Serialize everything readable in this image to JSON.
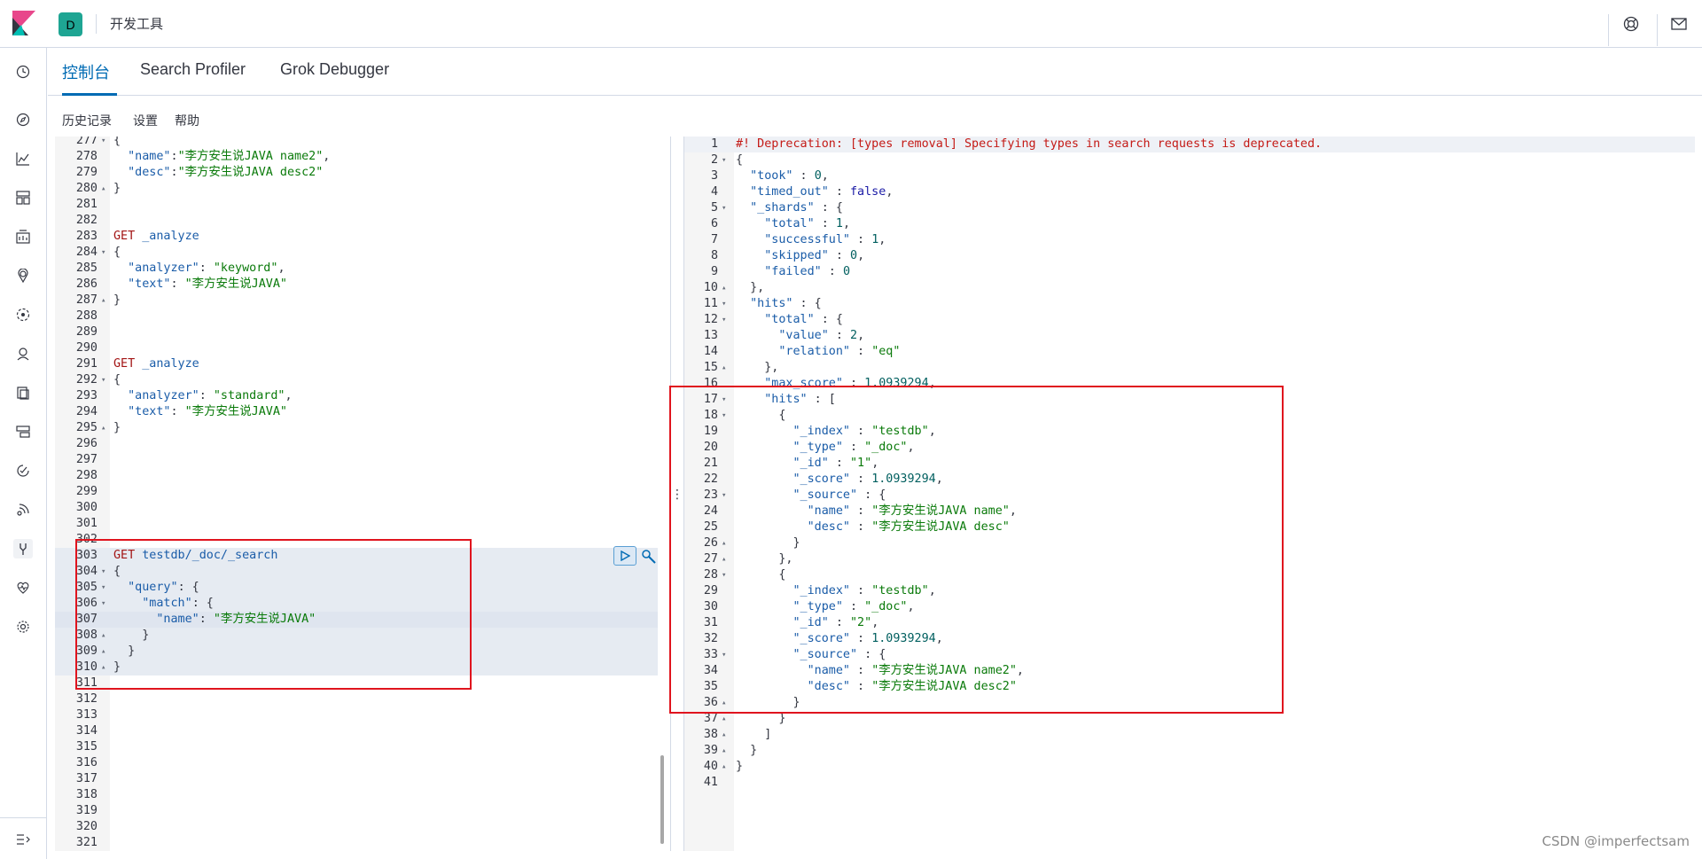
{
  "header": {
    "space_initial": "D",
    "app_title": "开发工具"
  },
  "tabs": [
    {
      "label": "控制台",
      "active": true
    },
    {
      "label": "Search Profiler",
      "active": false
    },
    {
      "label": "Grok Debugger",
      "active": false
    }
  ],
  "toolbar": {
    "history": "历史记录",
    "settings": "设置",
    "help": "帮助"
  },
  "request_editor": {
    "lines": [
      {
        "n": "277",
        "fold": "▾",
        "code": [
          [
            "{",
            "punc"
          ]
        ]
      },
      {
        "n": "278",
        "code": [
          [
            "  \"name\"",
            "key"
          ],
          [
            ":",
            "punc"
          ],
          [
            "\"李方安生说JAVA name2\"",
            "str"
          ],
          [
            ",",
            "punc"
          ]
        ]
      },
      {
        "n": "279",
        "code": [
          [
            "  \"desc\"",
            "key"
          ],
          [
            ":",
            "punc"
          ],
          [
            "\"李方安生说JAVA desc2\"",
            "str"
          ]
        ]
      },
      {
        "n": "280",
        "fold": "▴",
        "code": [
          [
            "}",
            "punc"
          ]
        ]
      },
      {
        "n": "281",
        "code": []
      },
      {
        "n": "282",
        "code": []
      },
      {
        "n": "283",
        "code": [
          [
            "GET",
            "method"
          ],
          [
            " _analyze",
            "path"
          ]
        ]
      },
      {
        "n": "284",
        "fold": "▾",
        "code": [
          [
            "{",
            "punc"
          ]
        ]
      },
      {
        "n": "285",
        "code": [
          [
            "  \"analyzer\"",
            "key"
          ],
          [
            ": ",
            "punc"
          ],
          [
            "\"keyword\"",
            "str"
          ],
          [
            ",",
            "punc"
          ]
        ]
      },
      {
        "n": "286",
        "code": [
          [
            "  \"text\"",
            "key"
          ],
          [
            ": ",
            "punc"
          ],
          [
            "\"李方安生说JAVA\"",
            "str"
          ]
        ]
      },
      {
        "n": "287",
        "fold": "▴",
        "code": [
          [
            "}",
            "punc"
          ]
        ]
      },
      {
        "n": "288",
        "code": []
      },
      {
        "n": "289",
        "code": []
      },
      {
        "n": "290",
        "code": []
      },
      {
        "n": "291",
        "code": [
          [
            "GET",
            "method"
          ],
          [
            " _analyze",
            "path"
          ]
        ]
      },
      {
        "n": "292",
        "fold": "▾",
        "code": [
          [
            "{",
            "punc"
          ]
        ]
      },
      {
        "n": "293",
        "code": [
          [
            "  \"analyzer\"",
            "key"
          ],
          [
            ": ",
            "punc"
          ],
          [
            "\"standard\"",
            "str"
          ],
          [
            ",",
            "punc"
          ]
        ]
      },
      {
        "n": "294",
        "code": [
          [
            "  \"text\"",
            "key"
          ],
          [
            ": ",
            "punc"
          ],
          [
            "\"李方安生说JAVA\"",
            "str"
          ]
        ]
      },
      {
        "n": "295",
        "fold": "▴",
        "code": [
          [
            "}",
            "punc"
          ]
        ]
      },
      {
        "n": "296",
        "code": []
      },
      {
        "n": "297",
        "code": []
      },
      {
        "n": "298",
        "code": []
      },
      {
        "n": "299",
        "code": []
      },
      {
        "n": "300",
        "code": []
      },
      {
        "n": "301",
        "code": []
      },
      {
        "n": "302",
        "code": []
      },
      {
        "n": "303",
        "code": [
          [
            "GET",
            "method"
          ],
          [
            " testdb/_doc/_search",
            "path"
          ]
        ]
      },
      {
        "n": "304",
        "fold": "▾",
        "code": [
          [
            "{",
            "punc"
          ]
        ]
      },
      {
        "n": "305",
        "fold": "▾",
        "code": [
          [
            "  \"query\"",
            "key"
          ],
          [
            ": {",
            "punc"
          ]
        ]
      },
      {
        "n": "306",
        "fold": "▾",
        "code": [
          [
            "    \"match\"",
            "key"
          ],
          [
            ": {",
            "punc"
          ]
        ]
      },
      {
        "n": "307",
        "code": [
          [
            "      \"name\"",
            "key"
          ],
          [
            ": ",
            "punc"
          ],
          [
            "\"李方安生说JAVA\"",
            "str"
          ]
        ]
      },
      {
        "n": "308",
        "fold": "▴",
        "code": [
          [
            "    }",
            "punc"
          ]
        ]
      },
      {
        "n": "309",
        "fold": "▴",
        "code": [
          [
            "  }",
            "punc"
          ]
        ]
      },
      {
        "n": "310",
        "fold": "▴",
        "code": [
          [
            "}",
            "punc"
          ]
        ]
      },
      {
        "n": "311",
        "code": []
      },
      {
        "n": "312",
        "code": []
      },
      {
        "n": "313",
        "code": []
      },
      {
        "n": "314",
        "code": []
      },
      {
        "n": "315",
        "code": []
      },
      {
        "n": "316",
        "code": []
      },
      {
        "n": "317",
        "code": []
      },
      {
        "n": "318",
        "code": []
      },
      {
        "n": "319",
        "code": []
      },
      {
        "n": "320",
        "code": []
      },
      {
        "n": "321",
        "code": []
      }
    ]
  },
  "response_editor": {
    "lines": [
      {
        "n": "1",
        "code": [
          [
            "#! Deprecation: [types removal] Specifying types in search requests is deprecated.",
            "comment"
          ]
        ]
      },
      {
        "n": "2",
        "fold": "▾",
        "code": [
          [
            "{",
            "punc"
          ]
        ]
      },
      {
        "n": "3",
        "code": [
          [
            "  \"took\"",
            "key"
          ],
          [
            " : ",
            "punc"
          ],
          [
            "0",
            "num"
          ],
          [
            ",",
            "punc"
          ]
        ]
      },
      {
        "n": "4",
        "code": [
          [
            "  \"timed_out\"",
            "key"
          ],
          [
            " : ",
            "punc"
          ],
          [
            "false",
            "bool"
          ],
          [
            ",",
            "punc"
          ]
        ]
      },
      {
        "n": "5",
        "fold": "▾",
        "code": [
          [
            "  \"_shards\"",
            "key"
          ],
          [
            " : {",
            "punc"
          ]
        ]
      },
      {
        "n": "6",
        "code": [
          [
            "    \"total\"",
            "key"
          ],
          [
            " : ",
            "punc"
          ],
          [
            "1",
            "num"
          ],
          [
            ",",
            "punc"
          ]
        ]
      },
      {
        "n": "7",
        "code": [
          [
            "    \"successful\"",
            "key"
          ],
          [
            " : ",
            "punc"
          ],
          [
            "1",
            "num"
          ],
          [
            ",",
            "punc"
          ]
        ]
      },
      {
        "n": "8",
        "code": [
          [
            "    \"skipped\"",
            "key"
          ],
          [
            " : ",
            "punc"
          ],
          [
            "0",
            "num"
          ],
          [
            ",",
            "punc"
          ]
        ]
      },
      {
        "n": "9",
        "code": [
          [
            "    \"failed\"",
            "key"
          ],
          [
            " : ",
            "punc"
          ],
          [
            "0",
            "num"
          ]
        ]
      },
      {
        "n": "10",
        "fold": "▴",
        "code": [
          [
            "  },",
            "punc"
          ]
        ]
      },
      {
        "n": "11",
        "fold": "▾",
        "code": [
          [
            "  \"hits\"",
            "key"
          ],
          [
            " : {",
            "punc"
          ]
        ]
      },
      {
        "n": "12",
        "fold": "▾",
        "code": [
          [
            "    \"total\"",
            "key"
          ],
          [
            " : {",
            "punc"
          ]
        ]
      },
      {
        "n": "13",
        "code": [
          [
            "      \"value\"",
            "key"
          ],
          [
            " : ",
            "punc"
          ],
          [
            "2",
            "num"
          ],
          [
            ",",
            "punc"
          ]
        ]
      },
      {
        "n": "14",
        "code": [
          [
            "      \"relation\"",
            "key"
          ],
          [
            " : ",
            "punc"
          ],
          [
            "\"eq\"",
            "str"
          ]
        ]
      },
      {
        "n": "15",
        "fold": "▴",
        "code": [
          [
            "    },",
            "punc"
          ]
        ]
      },
      {
        "n": "16",
        "code": [
          [
            "    \"max_score\"",
            "key"
          ],
          [
            " : ",
            "punc"
          ],
          [
            "1.0939294",
            "num"
          ],
          [
            ",",
            "punc"
          ]
        ]
      },
      {
        "n": "17",
        "fold": "▾",
        "code": [
          [
            "    \"hits\"",
            "key"
          ],
          [
            " : [",
            "punc"
          ]
        ]
      },
      {
        "n": "18",
        "fold": "▾",
        "code": [
          [
            "      {",
            "punc"
          ]
        ]
      },
      {
        "n": "19",
        "code": [
          [
            "        \"_index\"",
            "key"
          ],
          [
            " : ",
            "punc"
          ],
          [
            "\"testdb\"",
            "str"
          ],
          [
            ",",
            "punc"
          ]
        ]
      },
      {
        "n": "20",
        "code": [
          [
            "        \"_type\"",
            "key"
          ],
          [
            " : ",
            "punc"
          ],
          [
            "\"_doc\"",
            "str"
          ],
          [
            ",",
            "punc"
          ]
        ]
      },
      {
        "n": "21",
        "code": [
          [
            "        \"_id\"",
            "key"
          ],
          [
            " : ",
            "punc"
          ],
          [
            "\"1\"",
            "str"
          ],
          [
            ",",
            "punc"
          ]
        ]
      },
      {
        "n": "22",
        "code": [
          [
            "        \"_score\"",
            "key"
          ],
          [
            " : ",
            "punc"
          ],
          [
            "1.0939294",
            "num"
          ],
          [
            ",",
            "punc"
          ]
        ]
      },
      {
        "n": "23",
        "fold": "▾",
        "code": [
          [
            "        \"_source\"",
            "key"
          ],
          [
            " : {",
            "punc"
          ]
        ]
      },
      {
        "n": "24",
        "code": [
          [
            "          \"name\"",
            "key"
          ],
          [
            " : ",
            "punc"
          ],
          [
            "\"李方安生说JAVA name\"",
            "str"
          ],
          [
            ",",
            "punc"
          ]
        ]
      },
      {
        "n": "25",
        "code": [
          [
            "          \"desc\"",
            "key"
          ],
          [
            " : ",
            "punc"
          ],
          [
            "\"李方安生说JAVA desc\"",
            "str"
          ]
        ]
      },
      {
        "n": "26",
        "fold": "▴",
        "code": [
          [
            "        }",
            "punc"
          ]
        ]
      },
      {
        "n": "27",
        "fold": "▴",
        "code": [
          [
            "      },",
            "punc"
          ]
        ]
      },
      {
        "n": "28",
        "fold": "▾",
        "code": [
          [
            "      {",
            "punc"
          ]
        ]
      },
      {
        "n": "29",
        "code": [
          [
            "        \"_index\"",
            "key"
          ],
          [
            " : ",
            "punc"
          ],
          [
            "\"testdb\"",
            "str"
          ],
          [
            ",",
            "punc"
          ]
        ]
      },
      {
        "n": "30",
        "code": [
          [
            "        \"_type\"",
            "key"
          ],
          [
            " : ",
            "punc"
          ],
          [
            "\"_doc\"",
            "str"
          ],
          [
            ",",
            "punc"
          ]
        ]
      },
      {
        "n": "31",
        "code": [
          [
            "        \"_id\"",
            "key"
          ],
          [
            " : ",
            "punc"
          ],
          [
            "\"2\"",
            "str"
          ],
          [
            ",",
            "punc"
          ]
        ]
      },
      {
        "n": "32",
        "code": [
          [
            "        \"_score\"",
            "key"
          ],
          [
            " : ",
            "punc"
          ],
          [
            "1.0939294",
            "num"
          ],
          [
            ",",
            "punc"
          ]
        ]
      },
      {
        "n": "33",
        "fold": "▾",
        "code": [
          [
            "        \"_source\"",
            "key"
          ],
          [
            " : {",
            "punc"
          ]
        ]
      },
      {
        "n": "34",
        "code": [
          [
            "          \"name\"",
            "key"
          ],
          [
            " : ",
            "punc"
          ],
          [
            "\"李方安生说JAVA name2\"",
            "str"
          ],
          [
            ",",
            "punc"
          ]
        ]
      },
      {
        "n": "35",
        "code": [
          [
            "          \"desc\"",
            "key"
          ],
          [
            " : ",
            "punc"
          ],
          [
            "\"李方安生说JAVA desc2\"",
            "str"
          ]
        ]
      },
      {
        "n": "36",
        "fold": "▴",
        "code": [
          [
            "        }",
            "punc"
          ]
        ]
      },
      {
        "n": "37",
        "fold": "▴",
        "code": [
          [
            "      }",
            "punc"
          ]
        ]
      },
      {
        "n": "38",
        "fold": "▴",
        "code": [
          [
            "    ]",
            "punc"
          ]
        ]
      },
      {
        "n": "39",
        "fold": "▴",
        "code": [
          [
            "  }",
            "punc"
          ]
        ]
      },
      {
        "n": "40",
        "fold": "▴",
        "code": [
          [
            "}",
            "punc"
          ]
        ]
      },
      {
        "n": "41",
        "code": []
      }
    ]
  },
  "watermark": "CSDN @imperfectsam",
  "colors": {
    "accent": "#006bb4",
    "annotation_red": "#e0141e",
    "space_badge": "#1ea593"
  }
}
